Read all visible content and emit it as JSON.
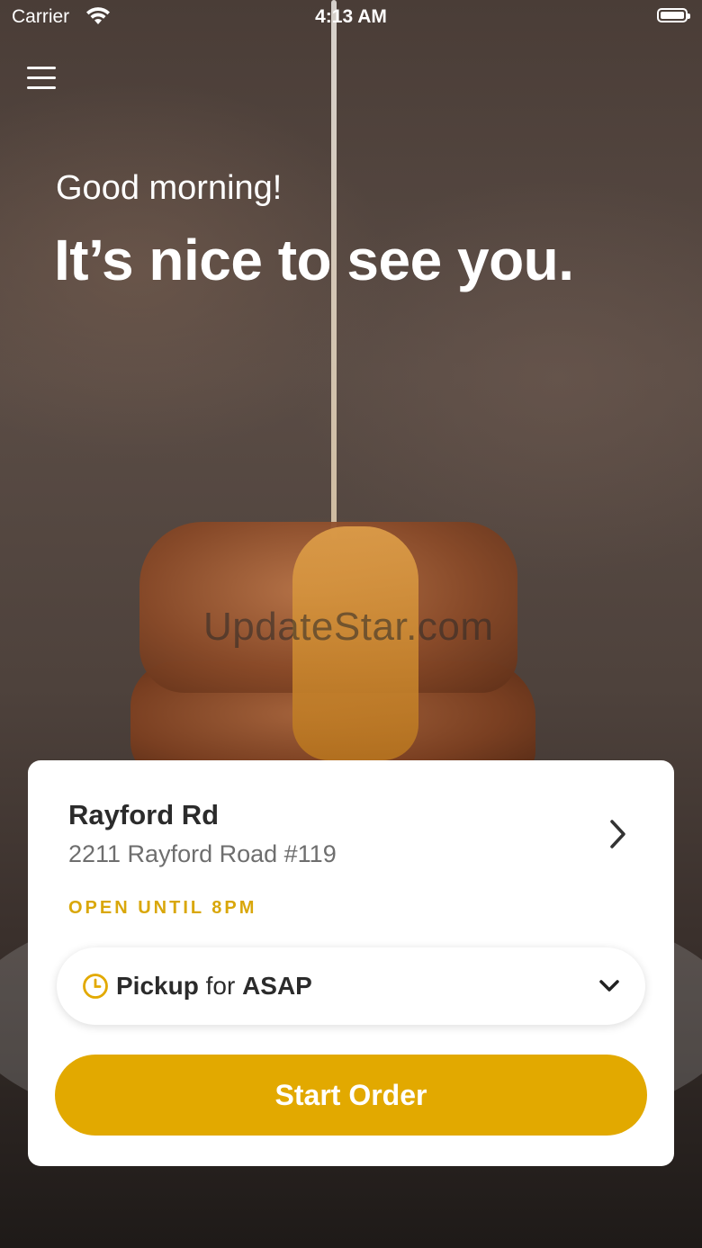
{
  "status_bar": {
    "carrier": "Carrier",
    "time": "4:13 AM",
    "wifi_icon": "wifi-icon",
    "battery_icon": "battery-icon"
  },
  "header": {
    "menu_icon": "hamburger-menu-icon",
    "greeting": "Good morning!",
    "headline": "It’s nice to see you."
  },
  "watermark": "UpdateStar.com",
  "store_card": {
    "name": "Rayford Rd",
    "address": "2211 Rayford Road #119",
    "hours": "OPEN UNTIL 8PM",
    "chevron_icon": "chevron-right-icon"
  },
  "order_options": {
    "clock_icon": "clock-icon",
    "mode": "Pickup",
    "connector": "for",
    "time": "ASAP",
    "dropdown_icon": "chevron-down-icon"
  },
  "start_button": {
    "label": "Start Order"
  },
  "colors": {
    "accent": "#e2a900",
    "hours_text": "#d9a70a",
    "card_bg": "#ffffff",
    "title_text": "#2b2b2b",
    "secondary_text": "#6e6e6e"
  }
}
